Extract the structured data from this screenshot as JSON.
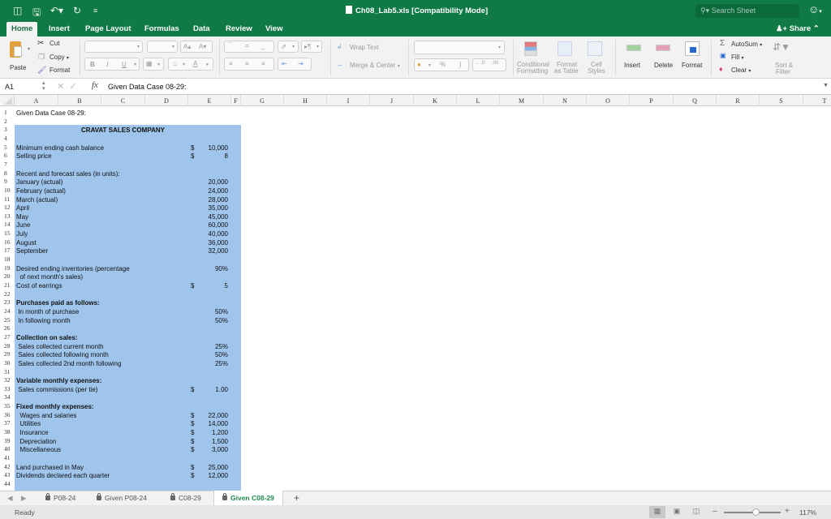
{
  "window": {
    "title": "Ch08_Lab5.xls  [Compatibility Mode]",
    "search_placeholder": "Search Sheet",
    "search_icon": "magnifier-icon"
  },
  "quick_access": [
    "sidebar-toggle-icon",
    "save-icon",
    "undo-icon",
    "redo-icon",
    "customize-icon"
  ],
  "ribbon_tabs": [
    {
      "label": "Home",
      "active": true
    },
    {
      "label": "Insert"
    },
    {
      "label": "Page Layout"
    },
    {
      "label": "Formulas"
    },
    {
      "label": "Data"
    },
    {
      "label": "Review"
    },
    {
      "label": "View"
    }
  ],
  "share_label": "Share",
  "ribbon": {
    "paste": "Paste",
    "cut": "Cut",
    "copy": "Copy",
    "format_painter": "Format",
    "bold": "B",
    "italic": "I",
    "underline": "U",
    "font_grow": "A",
    "font_shrink": "A",
    "font_color": "A",
    "wrap_text": "Wrap Text",
    "merge_center": "Merge & Center",
    "percent": "%",
    "comma": ")",
    "conditional_formatting_1": "Conditional",
    "conditional_formatting_2": "Formatting",
    "format_as_table_1": "Format",
    "format_as_table_2": "as Table",
    "cell_styles_1": "Cell",
    "cell_styles_2": "Styles",
    "insert": "Insert",
    "delete": "Delete",
    "format": "Format",
    "autosum": "AutoSum",
    "fill": "Fill",
    "clear": "Clear",
    "sort_filter_1": "Sort &",
    "sort_filter_2": "Filter"
  },
  "formula_bar": {
    "name_box": "A1",
    "fx": "fx",
    "content": "Given Data Case 08-29:"
  },
  "columns": [
    "A",
    "B",
    "C",
    "D",
    "E",
    "F",
    "G",
    "H",
    "I",
    "J",
    "K",
    "L",
    "M",
    "N",
    "O",
    "P",
    "Q",
    "R",
    "S",
    "T"
  ],
  "rows": [
    {
      "n": 1,
      "label": "Given Data Case 08-29:"
    },
    {
      "n": 2
    },
    {
      "n": 3,
      "title": "CRAVAT SALES COMPANY"
    },
    {
      "n": 4
    },
    {
      "n": 5,
      "label": "Minimum ending cash balance",
      "dollar": "$",
      "value": "10,000"
    },
    {
      "n": 6,
      "label": "Selling price",
      "dollar": "$",
      "value": "8"
    },
    {
      "n": 7
    },
    {
      "n": 8,
      "label": "Recent and forecast sales (in units):"
    },
    {
      "n": 9,
      "label": "January (actual)",
      "value": "20,000"
    },
    {
      "n": 10,
      "label": "February (actual)",
      "value": "24,000"
    },
    {
      "n": 11,
      "label": "March (actual)",
      "value": "28,000"
    },
    {
      "n": 12,
      "label": "April",
      "value": "35,000"
    },
    {
      "n": 13,
      "label": "May",
      "value": "45,000"
    },
    {
      "n": 14,
      "label": "June",
      "value": "60,000"
    },
    {
      "n": 15,
      "label": "July",
      "value": "40,000"
    },
    {
      "n": 16,
      "label": "August",
      "value": "36,000"
    },
    {
      "n": 17,
      "label": "September",
      "value": "32,000"
    },
    {
      "n": 18
    },
    {
      "n": 19,
      "label": "Desired ending inventories (percentage",
      "value": "90%"
    },
    {
      "n": 20,
      "label": "  of next month's sales)"
    },
    {
      "n": 21,
      "label": "Cost of earrings",
      "dollar": "$",
      "value": "5"
    },
    {
      "n": 22
    },
    {
      "n": 23,
      "label": "Purchases paid as follows:",
      "bold": true
    },
    {
      "n": 24,
      "label": " In month of purchase",
      "value": "50%"
    },
    {
      "n": 25,
      "label": " In following month",
      "value": "50%"
    },
    {
      "n": 26
    },
    {
      "n": 27,
      "label": "Collection on sales:",
      "bold": true
    },
    {
      "n": 28,
      "label": " Sales collected current month",
      "value": "25%"
    },
    {
      "n": 29,
      "label": " Sales collected following month",
      "value": "50%"
    },
    {
      "n": 30,
      "label": " Sales collected 2nd month following",
      "value": "25%"
    },
    {
      "n": 31
    },
    {
      "n": 32,
      "label": "Variable monthly expenses:",
      "bold": true
    },
    {
      "n": 33,
      "label": " Sales commissions (per tie)",
      "dollar": "$",
      "value": "1.00"
    },
    {
      "n": 34
    },
    {
      "n": 35,
      "label": "Fixed monthly expenses:",
      "bold": true
    },
    {
      "n": 36,
      "label": "  Wages and salaries",
      "dollar": "$",
      "value": "22,000"
    },
    {
      "n": 37,
      "label": "  Utilities",
      "dollar": "$",
      "value": "14,000"
    },
    {
      "n": 38,
      "label": "  Insurance",
      "dollar": "$",
      "value": "1,200"
    },
    {
      "n": 39,
      "label": "  Depreciation",
      "dollar": "$",
      "value": "1,500"
    },
    {
      "n": 40,
      "label": "  Miscellaneous",
      "dollar": "$",
      "value": "3,000"
    },
    {
      "n": 41
    },
    {
      "n": 42,
      "label": "Land purchased in May",
      "dollar": "$",
      "value": "25,000"
    },
    {
      "n": 43,
      "label": "Dividends declared each quarter",
      "dollar": "$",
      "value": "12,000"
    },
    {
      "n": 44
    }
  ],
  "sheet_tabs": [
    {
      "label": "P08-24",
      "locked": true
    },
    {
      "label": "Given P08-24",
      "locked": true
    },
    {
      "label": "C08-29",
      "locked": true
    },
    {
      "label": "Given C08-29",
      "locked": true,
      "active": true
    }
  ],
  "add_sheet": "+",
  "status": {
    "text": "Ready",
    "zoom": "117%",
    "zoom_fraction": 0.55
  },
  "colors": {
    "title_bar": "#0f7a45",
    "cell_fill": "#9fc5ec",
    "active_tab_text": "#1e8a4c"
  }
}
